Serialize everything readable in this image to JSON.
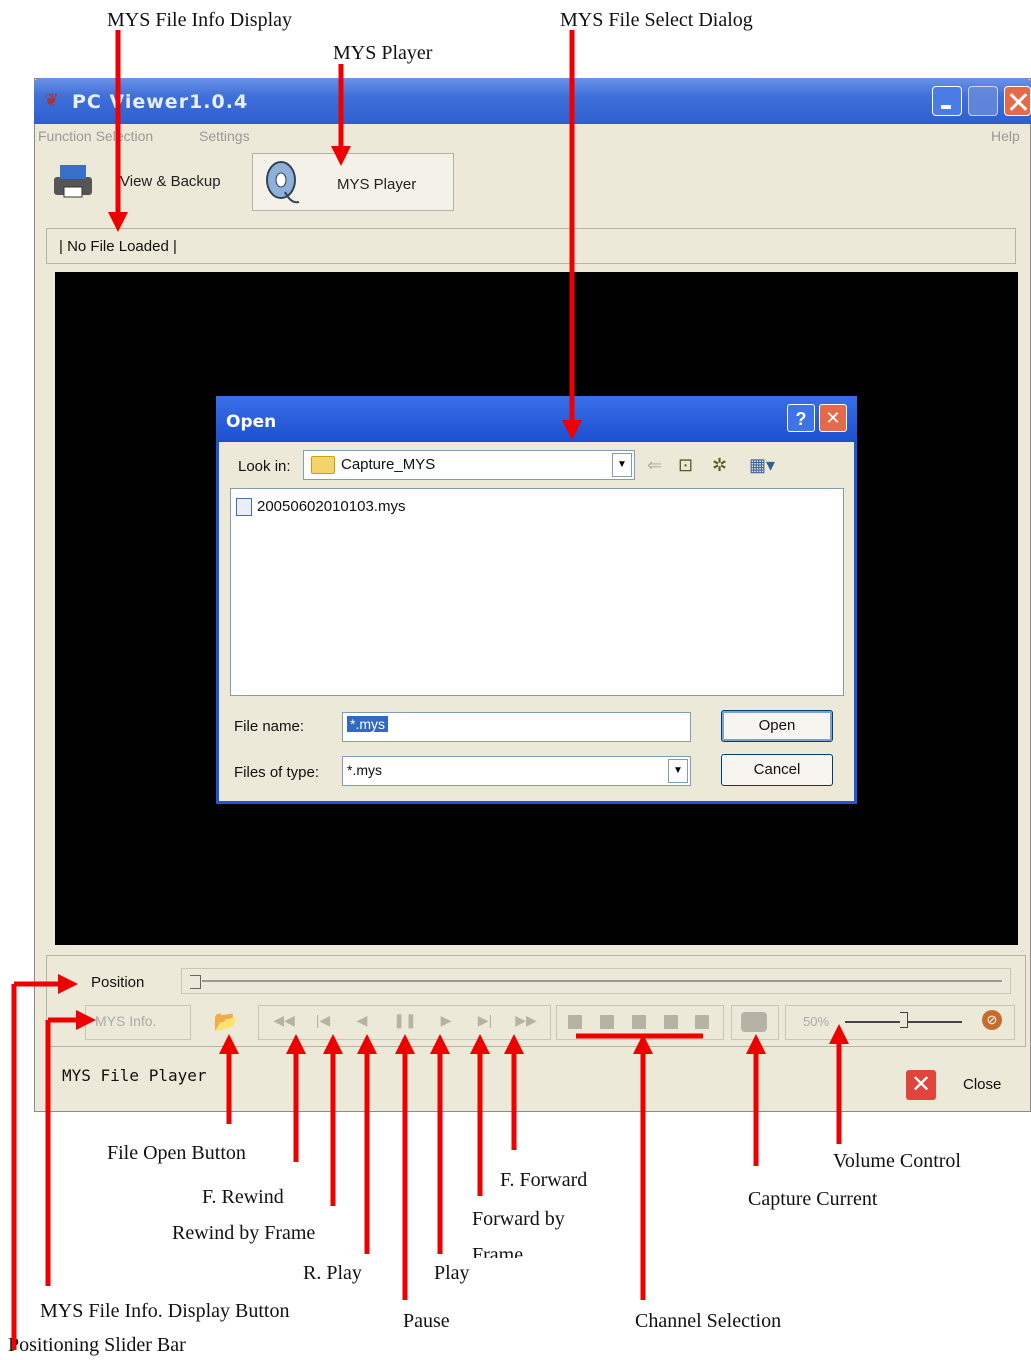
{
  "window": {
    "title": "PC Viewer1.0.4",
    "menu": {
      "function_selection": "Function Selection",
      "settings": "Settings",
      "help": "Help"
    },
    "tabs": [
      {
        "label": "View & Backup"
      },
      {
        "label": "MYS Player"
      }
    ],
    "info_text": "| No File Loaded |",
    "position_label": "Position",
    "mys_info_label": "MYS Info.",
    "volume_label": "50%",
    "volume_level": 0.5,
    "status_text": "MYS File Player",
    "close_label": "Close"
  },
  "dialog": {
    "title": "Open",
    "help_glyph": "?",
    "look_in_label": "Look in:",
    "look_in_value": "Capture_MYS",
    "files": [
      "20050602010103.mys"
    ],
    "file_name_label": "File name:",
    "file_name_value": "*.mys",
    "files_of_type_label": "Files of type:",
    "files_of_type_value": "*.mys",
    "open_button": "Open",
    "cancel_button": "Cancel"
  },
  "annotations": {
    "file_info_display": "MYS File Info Display",
    "player": "MYS Player",
    "file_select_dialog": "MYS File Select Dialog",
    "file_open_button": "File Open Button",
    "f_rewind": "F. Rewind",
    "rewind_by_frame": "Rewind by Frame",
    "r_play": "R. Play",
    "play": "Play",
    "pause": "Pause",
    "forward_by_frame_1": "Forward by",
    "forward_by_frame_2": "Frame",
    "f_forward": "F. Forward",
    "channel_selection": "Channel Selection",
    "capture_current": "Capture Current",
    "volume_control": "Volume Control",
    "file_info_display_button": "MYS File Info. Display Button",
    "positioning_slider_bar": "Positioning Slider Bar"
  },
  "colors": {
    "arrow": "#e00000",
    "title_bar": "#2e5fd0",
    "video_bg": "#000000"
  }
}
